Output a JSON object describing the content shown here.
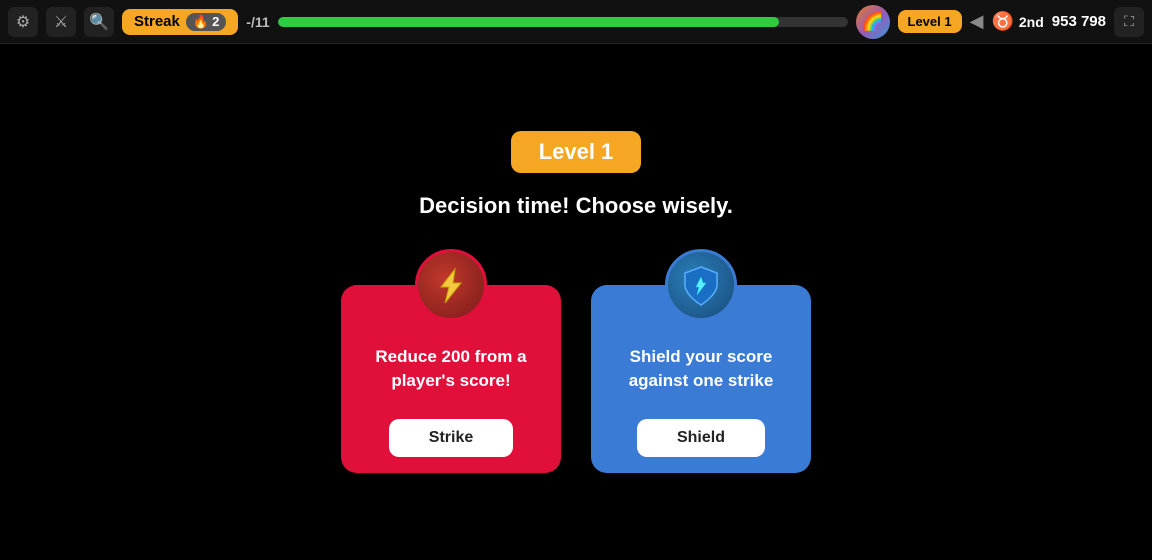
{
  "topbar": {
    "settings_icon": "⚙",
    "sword_icon": "⚔",
    "zoom_icon": "🔍",
    "streak_label": "Streak",
    "streak_count": "2",
    "question_counter": "-/11",
    "progress_percent": 88,
    "level_badge": "Level 1",
    "rank": "2nd",
    "score": "953 798",
    "fullscreen_icon": "⛶"
  },
  "main": {
    "level_title": "Level 1",
    "decision_text": "Decision time! Choose wisely.",
    "card_strike": {
      "icon": "⚡",
      "description": "Reduce 200 from a player's score!",
      "button_label": "Strike"
    },
    "card_shield": {
      "icon": "🛡",
      "description": "Shield your score against one strike",
      "button_label": "Shield"
    }
  }
}
